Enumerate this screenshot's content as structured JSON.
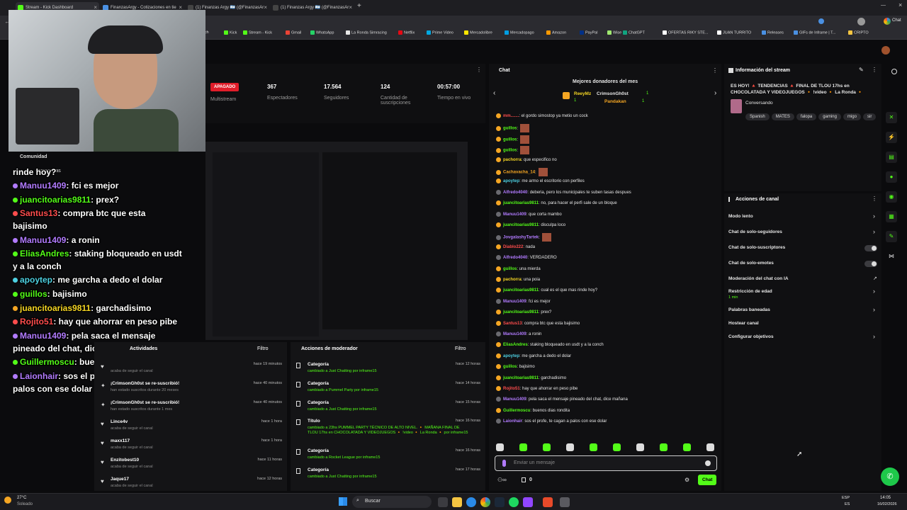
{
  "browser": {
    "tabs": [
      {
        "label": "Stream - Kick Dashboard",
        "color": "#53fc18"
      },
      {
        "label": "FinanzasArgy - Cotizaciones en tie",
        "color": "#4a90e2"
      },
      {
        "label": "(1) Finanzas Argy 🇦🇷 (@FinanzasAr",
        "color": "#222"
      },
      {
        "label": "(1) Finanzas Argy 🇦🇷 (@FinanzasAr",
        "color": "#222"
      }
    ],
    "bookmarks": [
      "Kick",
      "Stream - Kick",
      "Gmail",
      "WhatsApp",
      "La Ronda Simracing",
      "Netflix",
      "Prime Video",
      "Mercadolibre",
      "Mercadopago",
      "Amazon",
      "PayPal",
      "Wise",
      "ChatGPT",
      "OFERTAS RIKY STE...",
      "JUAN TURRITO",
      "Releases",
      "GIFs de Inframe | T...",
      "CRIPTO"
    ],
    "profile_label": "Chat",
    "bookmark_partial": "itch"
  },
  "stats": {
    "status": "APAGADO",
    "status_sub": "Multistream",
    "items": [
      {
        "value": "367",
        "label": "Espectadores"
      },
      {
        "value": "17.564",
        "label": "Seguidores"
      },
      {
        "value": "124",
        "label": "Cantidad de suscripciones"
      },
      {
        "value": "00:57:00",
        "label": "Tiempo en vivo"
      }
    ]
  },
  "chat": {
    "title": "Chat",
    "donors_title": "Mejores donadores del mes",
    "donors": [
      {
        "name": "ReeyMz",
        "amount": "1"
      },
      {
        "name": "CrimsonGh0st",
        "amount": "1"
      },
      {
        "name": "Pandakan",
        "amount": "1"
      }
    ],
    "messages": [
      {
        "user": "mm.......",
        "text": ": el gordo simostop ya metio un cock",
        "color": "#ff4d4d"
      },
      {
        "user": "guillos",
        "text": ":",
        "color": "#53fc18"
      },
      {
        "user": "guillos",
        "text": ":",
        "color": "#53fc18"
      },
      {
        "user": "guillos",
        "text": ":",
        "color": "#53fc18"
      },
      {
        "user": "pachorra",
        "text": ": que especifico no",
        "color": "#f5d623"
      },
      {
        "user": "Cachavacha_14",
        "text": ":",
        "color": "#f5a623"
      },
      {
        "user": "apoytep",
        "text": ": me armo el escritorio con perfiles",
        "color": "#4dd0e1"
      },
      {
        "user": "Alfredo4040",
        "text": ": deberia, pero los municipales te suben tasas despues",
        "color": "#b27bff"
      },
      {
        "user": "juancitoarias9811",
        "text": ": no, para hacer el perfi sale de un bloque",
        "color": "#53fc18"
      },
      {
        "user": "Manuu1409",
        "text": ": que corta mambo",
        "color": "#b27bff"
      },
      {
        "user": "juancitoarias9811",
        "text": ": disculpa loco",
        "color": "#53fc18"
      },
      {
        "user": "JovgalashyTartek",
        "text": ":",
        "color": "#b27bff"
      },
      {
        "user": "Diablo222",
        "text": ": nada",
        "color": "#ff4d4d"
      },
      {
        "user": "Alfredo4040",
        "text": ": VERDADERO",
        "color": "#b27bff"
      },
      {
        "user": "guillos",
        "text": ": una mierda",
        "color": "#53fc18"
      },
      {
        "user": "pachorra",
        "text": ": una poia",
        "color": "#f5d623"
      },
      {
        "user": "juancitoarias9811",
        "text": ": cual es el que mas rinde hoy?",
        "color": "#53fc18"
      },
      {
        "user": "Manuu1409",
        "text": ": fci es mejor",
        "color": "#b27bff"
      },
      {
        "user": "juancitoarias9811",
        "text": ": prex?",
        "color": "#53fc18"
      },
      {
        "user": "Santus13",
        "text": ": compra btc que esta bajisimo",
        "color": "#ff4d4d"
      },
      {
        "user": "Manuu1409",
        "text": ": a ronin",
        "color": "#b27bff"
      },
      {
        "user": "EliasAndres",
        "text": ": staking bloqueado en usdt y a la conch",
        "color": "#53fc18"
      },
      {
        "user": "apoytep",
        "text": ": me garcha a dedo el dolar",
        "color": "#4dd0e1"
      },
      {
        "user": "guillos",
        "text": ": bajisimo",
        "color": "#53fc18"
      },
      {
        "user": "juancitoarias9811",
        "text": ": garchadisimo",
        "color": "#53fc18"
      },
      {
        "user": "Rojito51",
        "text": ": hay que ahorrar en peso pibe",
        "color": "#ff4d4d"
      },
      {
        "user": "Manuu1409",
        "text": ": pela saca el mensaje pineado del chat, dice mañana",
        "color": "#b27bff"
      },
      {
        "user": "Guillermoscu",
        "text": ": buenos dias rondita",
        "color": "#53fc18"
      },
      {
        "user": "Laionhair",
        "text": ": sos el profe, te cagan a palos con ese dolar",
        "color": "#b27bff"
      }
    ],
    "input_placeholder": "Enviar un mensaje",
    "send_label": "Chat",
    "counter": "0"
  },
  "stream_info": {
    "title": "Información del stream",
    "text": "ES HOY! 🔺 TENDENCIAS 🔺 FINAL DE TLOU 17hs en CHOCOLATADA Y VIDEOJUEGOS 🔸 !video 🔸 La Ronda 🔸",
    "category": "Conversando",
    "tags": [
      "Spanish",
      "MATES",
      "falopa",
      "gaming",
      "migo",
      "sir"
    ]
  },
  "channel_actions": {
    "title": "Acciones de canal",
    "items": [
      {
        "label": "Modo lento",
        "type": "chevron"
      },
      {
        "label": "Chat de solo-seguidores",
        "type": "chevron"
      },
      {
        "label": "Chat de solo-suscriptores",
        "type": "toggle"
      },
      {
        "label": "Chat de solo-emotes",
        "type": "toggle"
      },
      {
        "label": "Moderación del chat con IA",
        "type": "link"
      },
      {
        "label": "Restricción de edad",
        "type": "chevron",
        "sub": "1 min"
      },
      {
        "label": "Palabras baneadas",
        "type": "chevron"
      },
      {
        "label": "Hostear canal",
        "type": "none"
      },
      {
        "label": "Configurar objetivos",
        "type": "chevron"
      }
    ]
  },
  "activity": {
    "title": "Actividades",
    "filter": "Filtro",
    "items": [
      {
        "user": "",
        "sub": "acaba de seguir el canal",
        "time": "hace 19 minutos"
      },
      {
        "user": "¡CrimsonGh0st se re-suscribió!",
        "sub": "han estado suscritos durante 20 meses",
        "time": "hace 40 minutos"
      },
      {
        "user": "¡CrimsonGh0st se re-suscribió!",
        "sub": "han estado suscritos durante 1 mes",
        "time": "hace 40 minutos"
      },
      {
        "user": "Lince4v",
        "sub": "acaba de seguir el canal",
        "time": "hace 1 hora"
      },
      {
        "user": "maxx117",
        "sub": "acaba de seguir el canal",
        "time": "hace 1 hora"
      },
      {
        "user": "Enzitobest10",
        "sub": "acaba de seguir el canal",
        "time": "hace 11 horas"
      },
      {
        "user": "Jaque17",
        "sub": "acaba de seguir el canal",
        "time": "hace 12 horas"
      }
    ]
  },
  "moderator": {
    "title": "Acciones de moderador",
    "filter": "Filtro",
    "items": [
      {
        "kind": "Categoría",
        "detail": "cambiado a Just Chatting por inframe15",
        "time": "hace 12 horas"
      },
      {
        "kind": "Categoría",
        "detail": "cambiado a Pummel Party por inframe15",
        "time": "hace 14 horas"
      },
      {
        "kind": "Categoría",
        "detail": "cambiado a Just Chatting por inframe15",
        "time": "hace 15 horas"
      },
      {
        "kind": "Título",
        "detail": "cambiado a 23hs PUMMEL PARTY TÉCNICO DE ALTO NIVEL. 🔸 MAÑANA FINAL DE TLOU 17hs en CHOCOLATADA Y VIDEOJUEGOS 🔸 !video 🔸 La Ronda 🔸 por inframe15",
        "time": "hace 16 horas"
      },
      {
        "kind": "Categoría",
        "detail": "cambiado a Rocket League por inframe15",
        "time": "hace 16 horas"
      },
      {
        "kind": "Categoría",
        "detail": "cambiado a Just Chatting por inframe15",
        "time": "hace 17 horas"
      }
    ]
  },
  "overlay": {
    "header": "Comunidad",
    "subheader": "compensas",
    "lines": [
      {
        "user": "",
        "text": "rinde hoy?",
        "cls": ""
      },
      {
        "user": "Manuu1409",
        "text": ": fci es mejor",
        "cls": "u"
      },
      {
        "user": "juancitoarias9811",
        "text": ": prex?",
        "cls": "g"
      },
      {
        "user": "Santus13",
        "text": ": compra btc que esta",
        "cls": "r"
      },
      {
        "user": "",
        "text": "bajisimo",
        "cls": ""
      },
      {
        "user": "Manuu1409",
        "text": ": a ronin",
        "cls": "u"
      },
      {
        "user": "EliasAndres",
        "text": ": staking bloqueado en usdt",
        "cls": "g"
      },
      {
        "user": "",
        "text": "y a la conch",
        "cls": ""
      },
      {
        "user": "apoytep",
        "text": ": me garcha a dedo el dolar",
        "cls": "c"
      },
      {
        "user": "guillos",
        "text": ": bajisimo",
        "cls": "g"
      },
      {
        "user": "juancitoarias9811",
        "text": ": garchadisimo",
        "cls": "y"
      },
      {
        "user": "Rojito51",
        "text": ": hay que ahorrar en peso pibe",
        "cls": "r"
      },
      {
        "user": "Manuu1409",
        "text": ": pela saca el mensaje",
        "cls": "u"
      },
      {
        "user": "",
        "text": "pineado del chat, dice mañana",
        "cls": ""
      },
      {
        "user": "Guillermoscu",
        "text": ": buenos dias rondita",
        "cls": "g"
      },
      {
        "user": "Laionhair",
        "text": ": sos el profe, te cagan a",
        "cls": "u"
      },
      {
        "user": "",
        "text": "palos con ese dolar",
        "cls": ""
      }
    ]
  },
  "taskbar": {
    "weather_temp": "27°C",
    "weather_label": "Soleado",
    "search": "Buscar",
    "lang": "ESP",
    "lang2": "ES",
    "time": "14:05",
    "date": "16/02/2026"
  },
  "colors": {
    "accent": "#53fc18",
    "bg": "#0b0b0d",
    "panel": "#141416"
  }
}
